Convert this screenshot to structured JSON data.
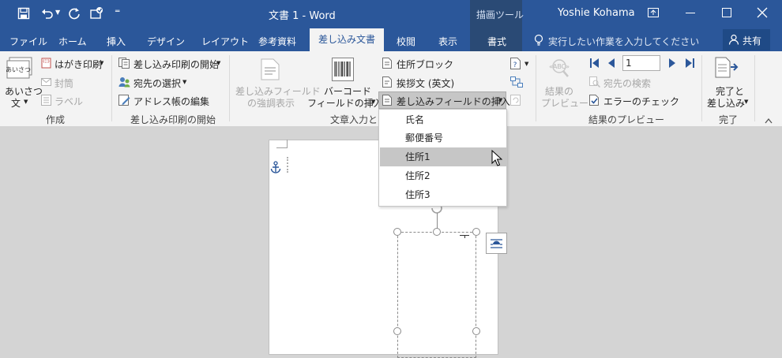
{
  "title": "文書 1 - Word",
  "context_tab_group": "描画ツール",
  "user": "Yoshie Kohama",
  "tabs": [
    "ファイル",
    "ホーム",
    "挿入",
    "デザイン",
    "レイアウト",
    "参考資料",
    "差し込み文書",
    "校閲",
    "表示",
    "書式"
  ],
  "tell_me": "実行したい作業を入力してください",
  "share": "共有",
  "ribbon": {
    "create": {
      "greeting_line1": "あいさつ",
      "greeting_line2": "文",
      "postcard": "はがき印刷",
      "envelope": "封筒",
      "label": "ラベル",
      "group": "作成"
    },
    "start": {
      "start_merge": "差し込み印刷の開始",
      "select_recipients": "宛先の選択",
      "edit_list": "アドレス帳の編集",
      "group": "差し込み印刷の開始"
    },
    "fields": {
      "highlight_line1": "差し込みフィールド",
      "highlight_line2": "の強調表示",
      "barcode_line1": "バーコード",
      "barcode_line2": "フィールドの挿入",
      "address_block": "住所ブロック",
      "greeting_text": "挨拶文 (英文)",
      "insert_field": "差し込みフィールドの挿入",
      "group": "文章入力とフ"
    },
    "preview": {
      "results_line1": "結果の",
      "results_line2": "プレビュー",
      "record_number": "1",
      "find_recipient": "宛先の検索",
      "check_errors": "エラーのチェック",
      "group": "結果のプレビュー"
    },
    "finish": {
      "finish_line1": "完了と",
      "finish_line2": "差し込み",
      "group": "完了"
    }
  },
  "dropdown": {
    "items": [
      "氏名",
      "郵便番号",
      "住所1",
      "住所2",
      "住所3"
    ],
    "selected": "住所1"
  },
  "colors": {
    "brand": "#2b579a",
    "context_tab": "#2a4a75",
    "ribbon_bg": "#f3f3f3",
    "doc_bg": "#d4d4d4",
    "menu_selected": "#c6c6c6"
  }
}
